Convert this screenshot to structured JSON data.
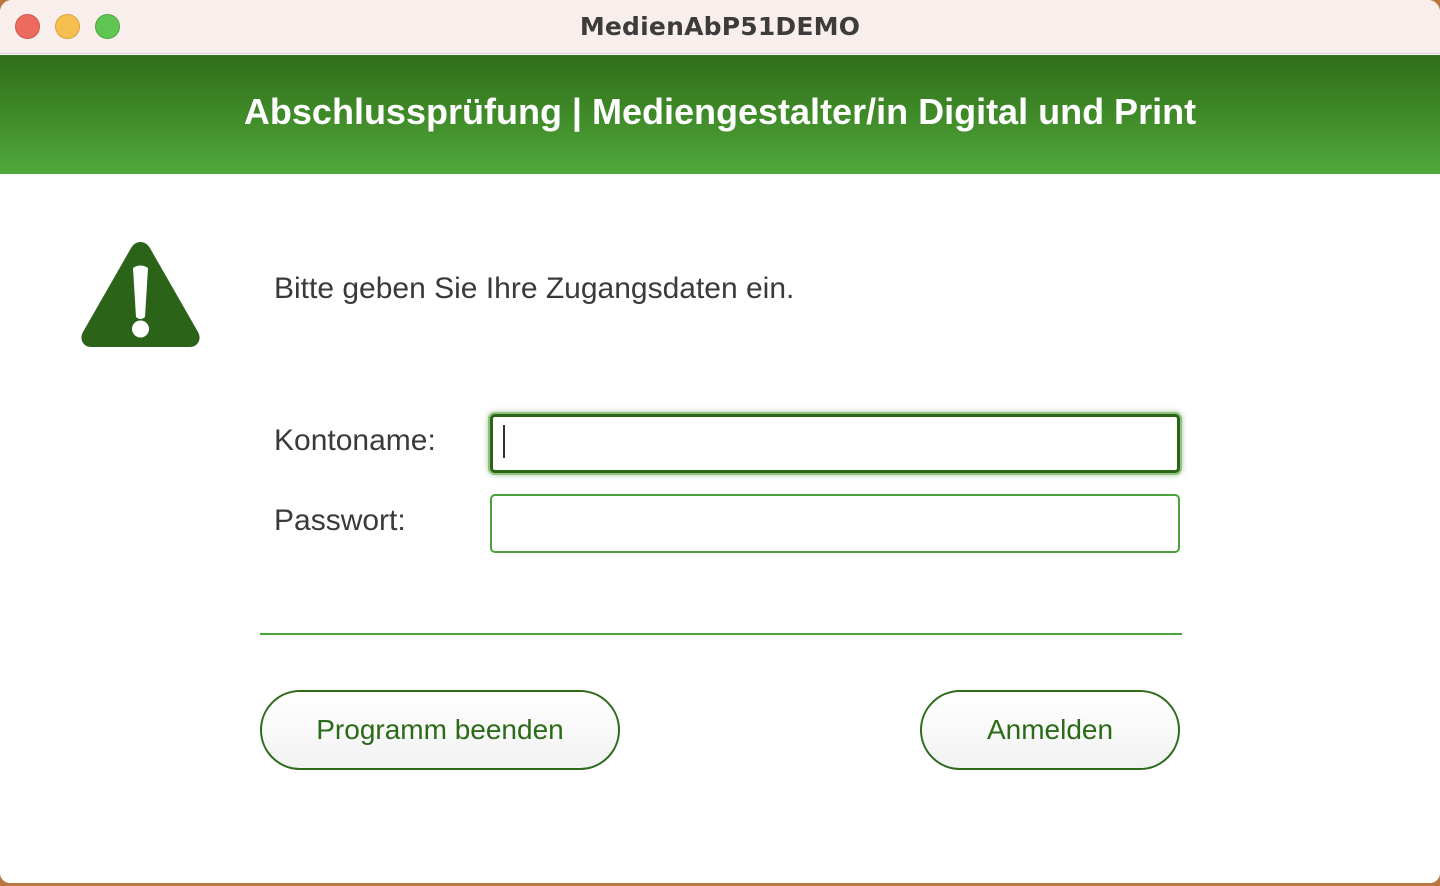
{
  "window": {
    "title": "MedienAbP51DEMO"
  },
  "banner": {
    "title": "Abschlussprüfung | Mediengestalter/in Digital und Print"
  },
  "dialog": {
    "icon": "warning-icon",
    "prompt": "Bitte geben Sie Ihre Zugangsdaten ein.",
    "account_label": "Kontoname:",
    "account_value": "",
    "password_label": "Passwort:",
    "password_value": ""
  },
  "buttons": {
    "quit_label": "Programm beenden",
    "login_label": "Anmelden"
  },
  "colors": {
    "accent_dark": "#2c6418",
    "accent": "#4aa33a",
    "banner_top": "#2f6e1b",
    "banner_bottom": "#52a83c"
  }
}
